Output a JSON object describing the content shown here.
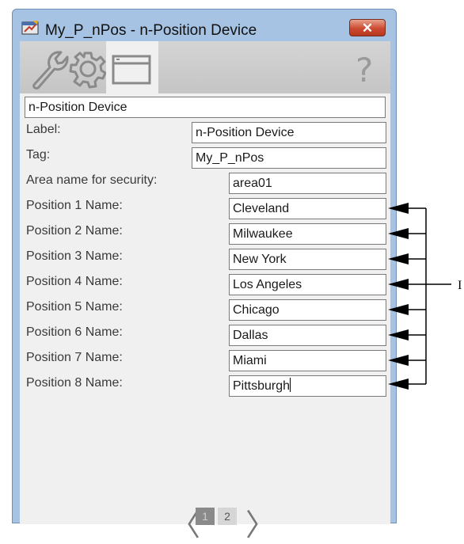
{
  "window": {
    "title": "My_P_nPos - n-Position Device",
    "close_label": "✕"
  },
  "toolbar": {
    "icons": [
      "wrench-icon",
      "gear-icon",
      "window-icon"
    ],
    "help": "?"
  },
  "form": {
    "header_value": "n-Position Device",
    "fields": [
      {
        "label": "Label:",
        "value": "n-Position Device"
      },
      {
        "label": "Tag:",
        "value": "My_P_nPos"
      },
      {
        "label": "Area name for security:",
        "value": "area01"
      },
      {
        "label": "Position 1 Name:",
        "value": "Cleveland"
      },
      {
        "label": "Position 2 Name:",
        "value": "Milwaukee"
      },
      {
        "label": "Position 3 Name:",
        "value": "New York"
      },
      {
        "label": "Position 4 Name:",
        "value": "Los Angeles"
      },
      {
        "label": "Position 5 Name:",
        "value": "Chicago"
      },
      {
        "label": "Position 6 Name:",
        "value": "Dallas"
      },
      {
        "label": "Position 7 Name:",
        "value": "Miami"
      },
      {
        "label": "Position 8 Name:",
        "value": "Pittsburgh"
      }
    ]
  },
  "pager": {
    "prev": "〈",
    "next": "〉",
    "pages": [
      "1",
      "2"
    ],
    "current": "1"
  },
  "callout": {
    "text": "I"
  }
}
